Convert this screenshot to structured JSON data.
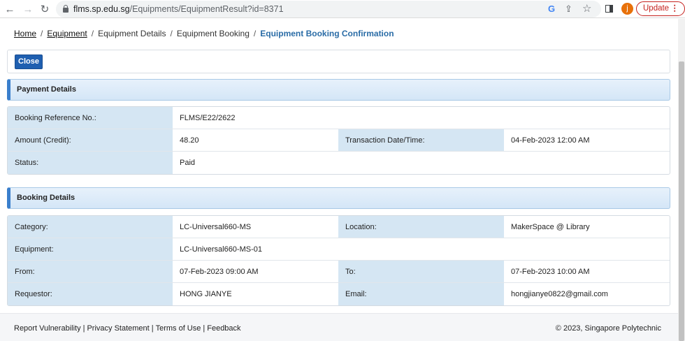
{
  "browser": {
    "url_host": "flms.sp.edu.sg",
    "url_path": "/Equipments/EquipmentResult?id=8371",
    "avatar_letter": "j",
    "update_label": "Update",
    "menu_glyph": "⋮"
  },
  "breadcrumb": {
    "items": [
      "Home",
      "Equipment",
      "Equipment Details",
      "Equipment Booking"
    ],
    "current": "Equipment Booking Confirmation",
    "separator": "/"
  },
  "actions": {
    "close_label": "Close"
  },
  "payment": {
    "title": "Payment Details",
    "booking_ref_label": "Booking Reference No.:",
    "booking_ref_value": "FLMS/E22/2622",
    "amount_label": "Amount (Credit):",
    "amount_value": "48.20",
    "transaction_label": "Transaction Date/Time:",
    "transaction_value": "04-Feb-2023 12:00 AM",
    "status_label": "Status:",
    "status_value": "Paid"
  },
  "booking": {
    "title": "Booking Details",
    "category_label": "Category:",
    "category_value": "LC-Universal660-MS",
    "location_label": "Location:",
    "location_value": "MakerSpace @ Library",
    "equipment_label": "Equipment:",
    "equipment_value": "LC-Universal660-MS-01",
    "from_label": "From:",
    "from_value": "07-Feb-2023 09:00 AM",
    "to_label": "To:",
    "to_value": "07-Feb-2023 10:00 AM",
    "requestor_label": "Requestor:",
    "requestor_value": "HONG JIANYE",
    "email_label": "Email:",
    "email_value": "hongjianye0822@gmail.com"
  },
  "footer": {
    "links": [
      "Report Vulnerability",
      "Privacy Statement",
      "Terms of Use",
      "Feedback"
    ],
    "link_separator": "|",
    "copyright": "© 2023, Singapore Polytechnic"
  },
  "colors": {
    "accent": "#2a6ca6",
    "button": "#1f5fb0",
    "label_bg": "#d5e6f3",
    "update": "#c5221f"
  }
}
